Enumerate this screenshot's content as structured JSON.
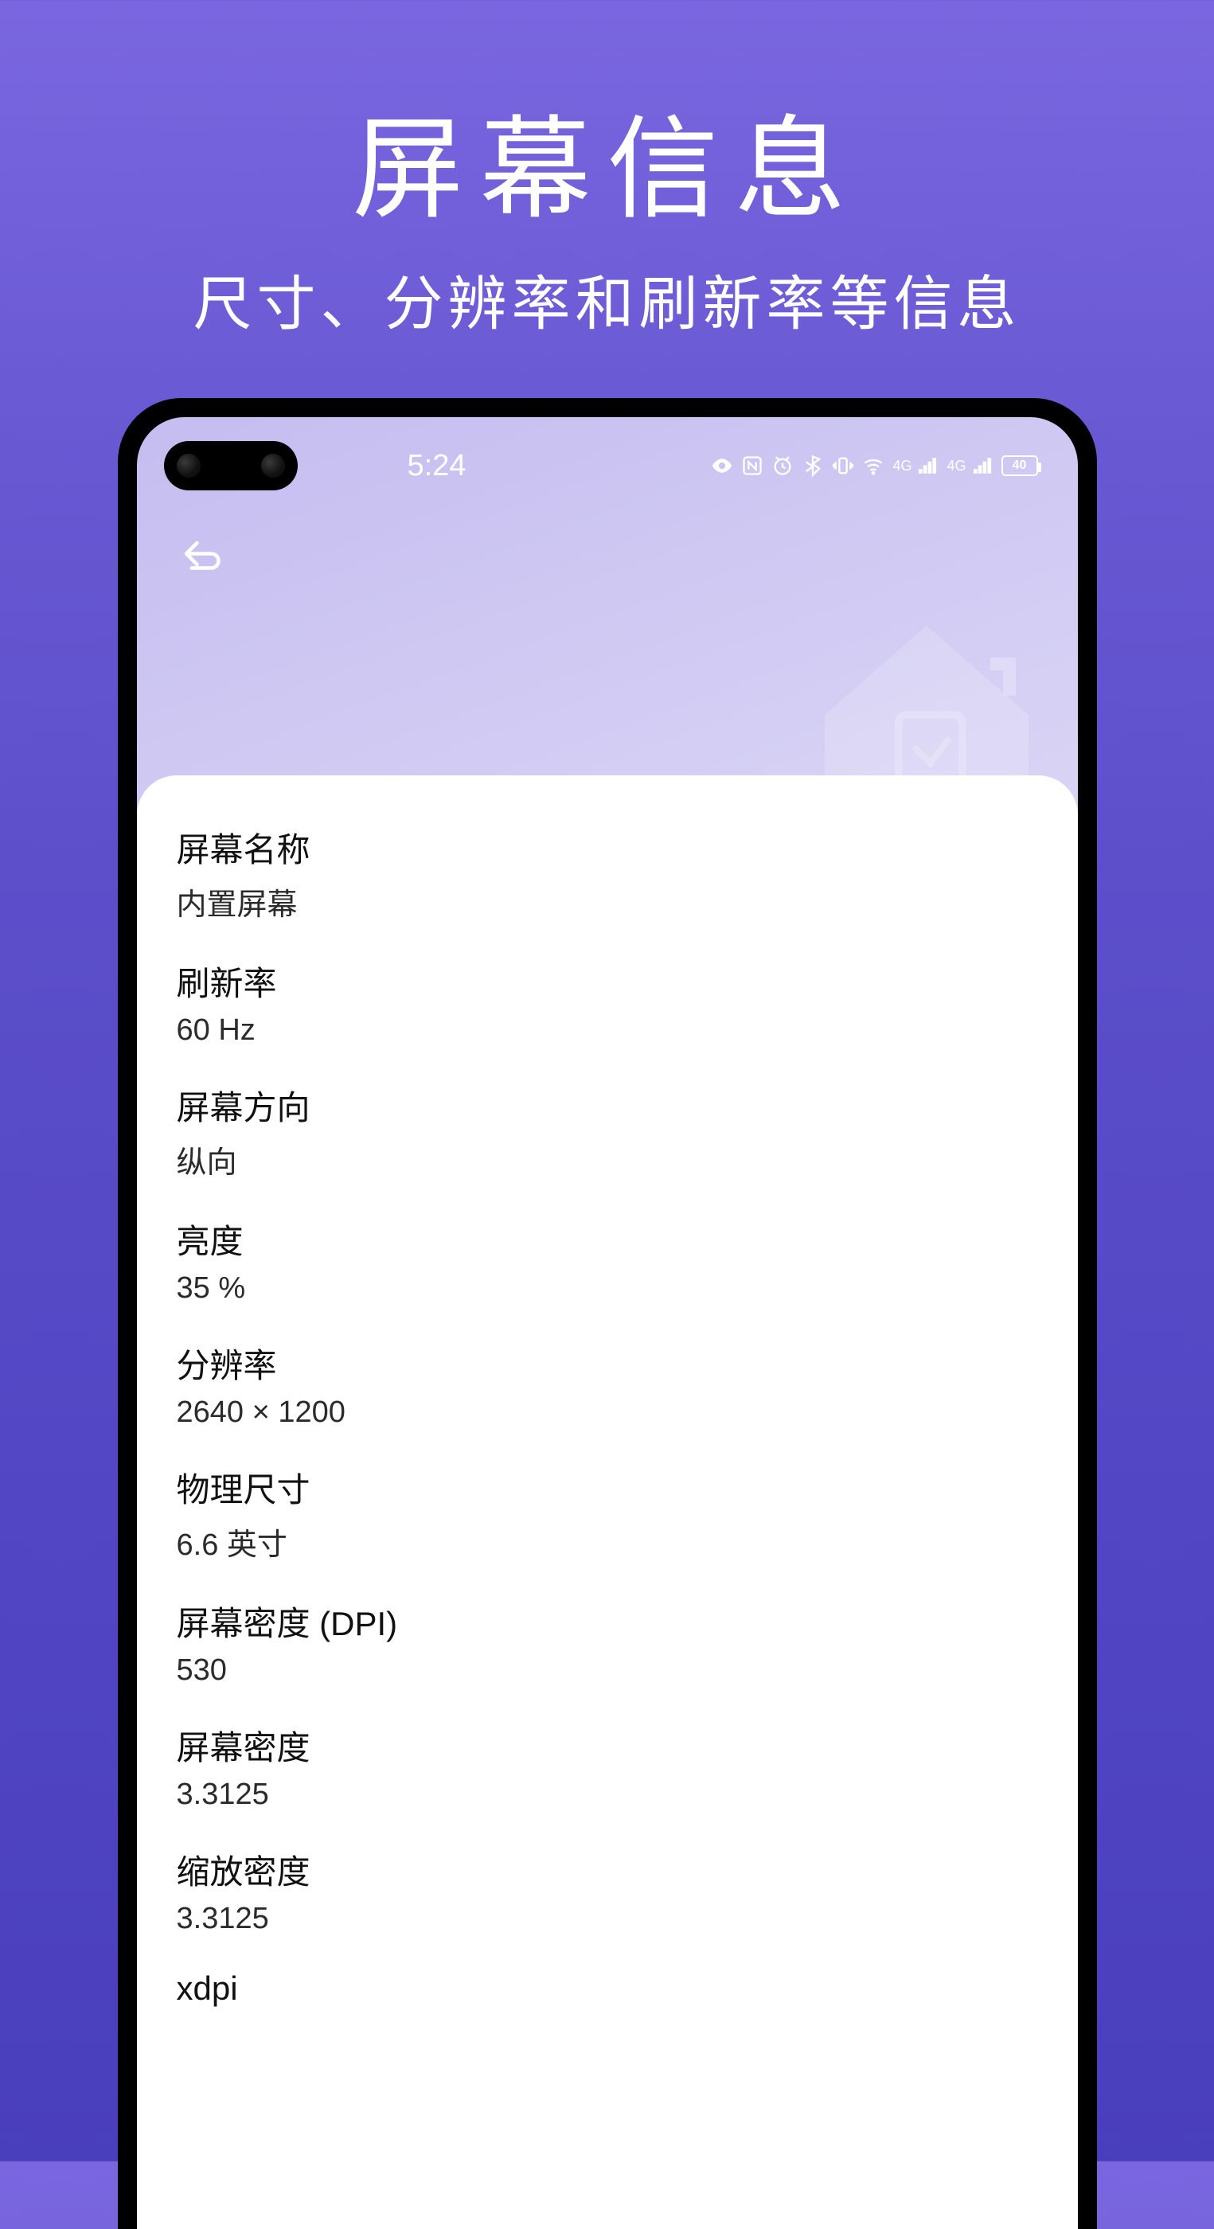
{
  "header": {
    "title": "屏幕信息",
    "subtitle": "尺寸、分辨率和刷新率等信息"
  },
  "status": {
    "time": "5:24",
    "battery": "40"
  },
  "info": [
    {
      "label": "屏幕名称",
      "value": "内置屏幕"
    },
    {
      "label": "刷新率",
      "value": "60 Hz"
    },
    {
      "label": "屏幕方向",
      "value": "纵向"
    },
    {
      "label": "亮度",
      "value": "35 %"
    },
    {
      "label": "分辨率",
      "value": "2640 × 1200"
    },
    {
      "label": "物理尺寸",
      "value": "6.6 英寸"
    },
    {
      "label": "屏幕密度 (DPI)",
      "value": "530"
    },
    {
      "label": "屏幕密度",
      "value": "3.3125"
    },
    {
      "label": "缩放密度",
      "value": "3.3125"
    },
    {
      "label": "xdpi",
      "value": ""
    }
  ]
}
